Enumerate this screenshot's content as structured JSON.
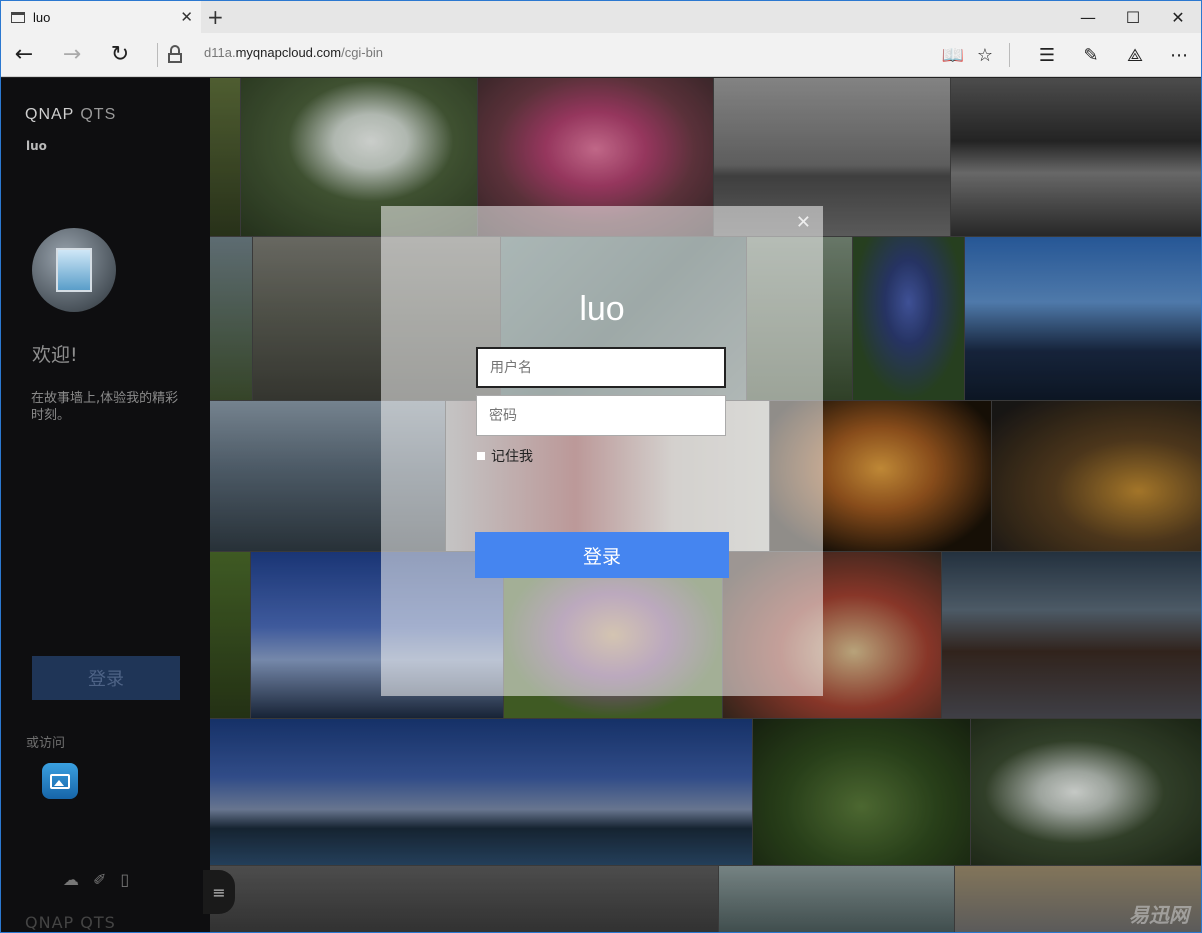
{
  "browser": {
    "tab_title": "luo",
    "url_prefix": "d11a.",
    "url_host": "myqnapcloud.com",
    "url_path": "/cgi-bin"
  },
  "sidebar": {
    "brand": "QNAP",
    "brand_sub": "QTS",
    "device_name": "luo",
    "welcome": "欢迎!",
    "tagline": "在故事墙上,体验我的精彩时刻。",
    "login_label": "登录",
    "or_visit": "或访问",
    "footer_brand": "QNAP QTS"
  },
  "dialog": {
    "title": "luo",
    "username_placeholder": "用户名",
    "password_placeholder": "密码",
    "remember_label": "记住我",
    "login_label": "登录"
  },
  "watermark": "易迅网",
  "icons": [
    "tab-page-icon",
    "close-icon",
    "plus-icon",
    "minimize-icon",
    "maximize-icon",
    "back-icon",
    "forward-icon",
    "refresh-icon",
    "lock-icon",
    "reading-view-icon",
    "star-icon",
    "hub-icon",
    "web-note-icon",
    "share-icon",
    "more-icon",
    "cloud-icon",
    "tools-icon",
    "book-icon",
    "menu-icon",
    "photo-app-icon"
  ]
}
